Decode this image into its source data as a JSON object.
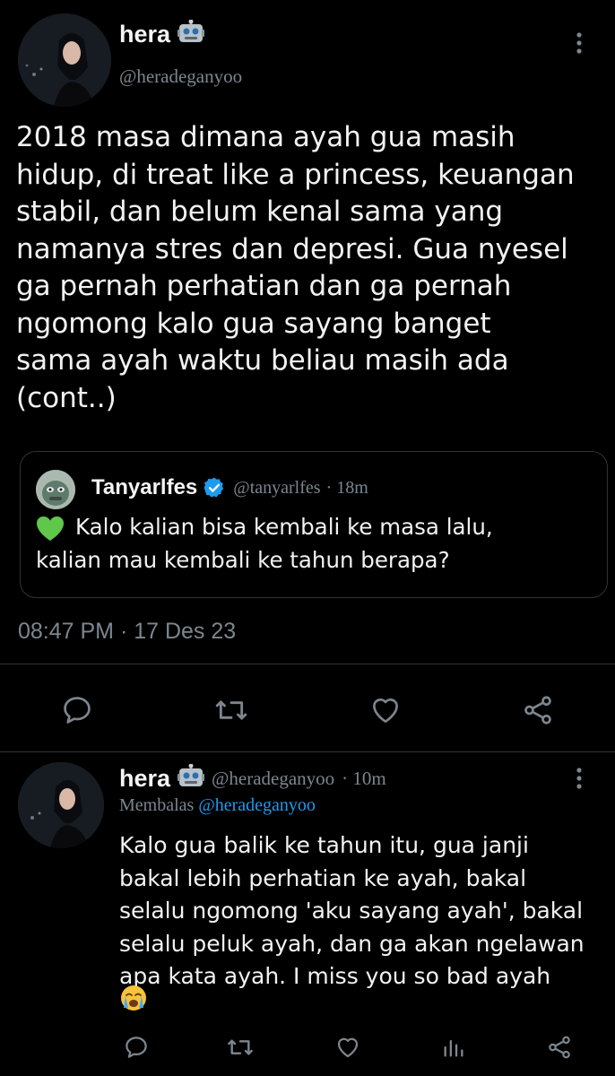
{
  "main_tweet": {
    "display_name": "hera",
    "handle": "@heradeganyoo",
    "text_lines": [
      "2018 masa dimana ayah gua masih",
      "hidup, di treat like a princess, keuangan",
      "stabil, dan belum kenal sama yang",
      "namanya stres dan depresi. Gua nyesel",
      "ga pernah perhatian dan ga pernah",
      "ngomong kalo gua sayang banget",
      "sama ayah waktu beliau masih ada",
      "(cont..)"
    ],
    "timestamp": "08:47 PM · 17 Des 23"
  },
  "quote": {
    "display_name": "Tanyarlfes",
    "handle": "@tanyarlfes",
    "time": "· 18m",
    "text_line1": "Kalo kalian bisa kembali ke masa lalu,",
    "text_line2": "kalian mau kembali ke tahun berapa?"
  },
  "reply": {
    "display_name": "hera",
    "handle": "@heradeganyoo",
    "time": "· 10m",
    "replying_label": "Membalas",
    "replying_to": "@heradeganyoo",
    "text_lines": [
      "Kalo gua balik ke tahun itu, gua janji",
      "bakal lebih perhatian ke ayah, bakal",
      "selalu ngomong 'aku sayang ayah', bakal",
      "selalu peluk ayah, dan ga akan ngelawan",
      "apa kata ayah. I miss you so bad ayah"
    ]
  },
  "icons": [
    "robot-emoji",
    "more-vertical-icon",
    "verified-badge-icon",
    "green-heart-emoji",
    "reply-icon",
    "retweet-icon",
    "like-icon",
    "share-icon",
    "views-icon",
    "crying-emoji"
  ],
  "colors": {
    "background": "#000000",
    "text": "#ffffff",
    "secondary": "#71767b",
    "link": "#1d9bf0",
    "divider": "#2f3336"
  }
}
